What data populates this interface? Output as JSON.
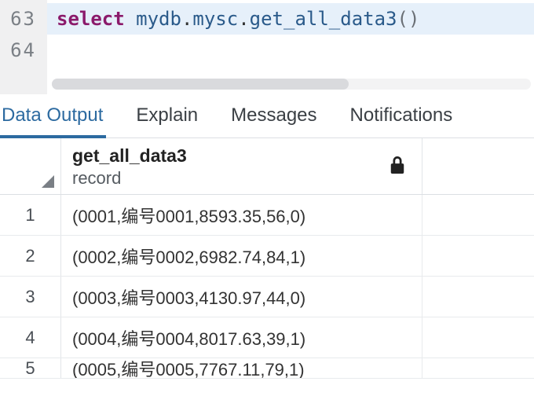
{
  "editor": {
    "lines": [
      {
        "num": "63",
        "segments": [
          {
            "cls": "kw",
            "text": "select"
          },
          {
            "cls": "",
            "text": " "
          },
          {
            "cls": "ident",
            "text": "mydb"
          },
          {
            "cls": "",
            "text": "."
          },
          {
            "cls": "ident",
            "text": "mysc"
          },
          {
            "cls": "",
            "text": "."
          },
          {
            "cls": "ident",
            "text": "get_all_data3"
          },
          {
            "cls": "paren",
            "text": "()"
          }
        ],
        "highlighted": true
      },
      {
        "num": "64",
        "segments": [],
        "highlighted": false
      }
    ]
  },
  "tabs": [
    {
      "id": "data-output",
      "label": "Data Output",
      "active": true
    },
    {
      "id": "explain",
      "label": "Explain",
      "active": false
    },
    {
      "id": "messages",
      "label": "Messages",
      "active": false
    },
    {
      "id": "notifications",
      "label": "Notifications",
      "active": false
    }
  ],
  "result": {
    "column": {
      "name": "get_all_data3",
      "type": "record",
      "locked": true
    },
    "rows": [
      {
        "n": "1",
        "v": "(0001,编号0001,8593.35,56,0)"
      },
      {
        "n": "2",
        "v": "(0002,编号0002,6982.74,84,1)"
      },
      {
        "n": "3",
        "v": "(0003,编号0003,4130.97,44,0)"
      },
      {
        "n": "4",
        "v": "(0004,编号0004,8017.63,39,1)"
      },
      {
        "n": "5",
        "v": "(0005,编号0005,7767.11,79,1)"
      }
    ]
  }
}
